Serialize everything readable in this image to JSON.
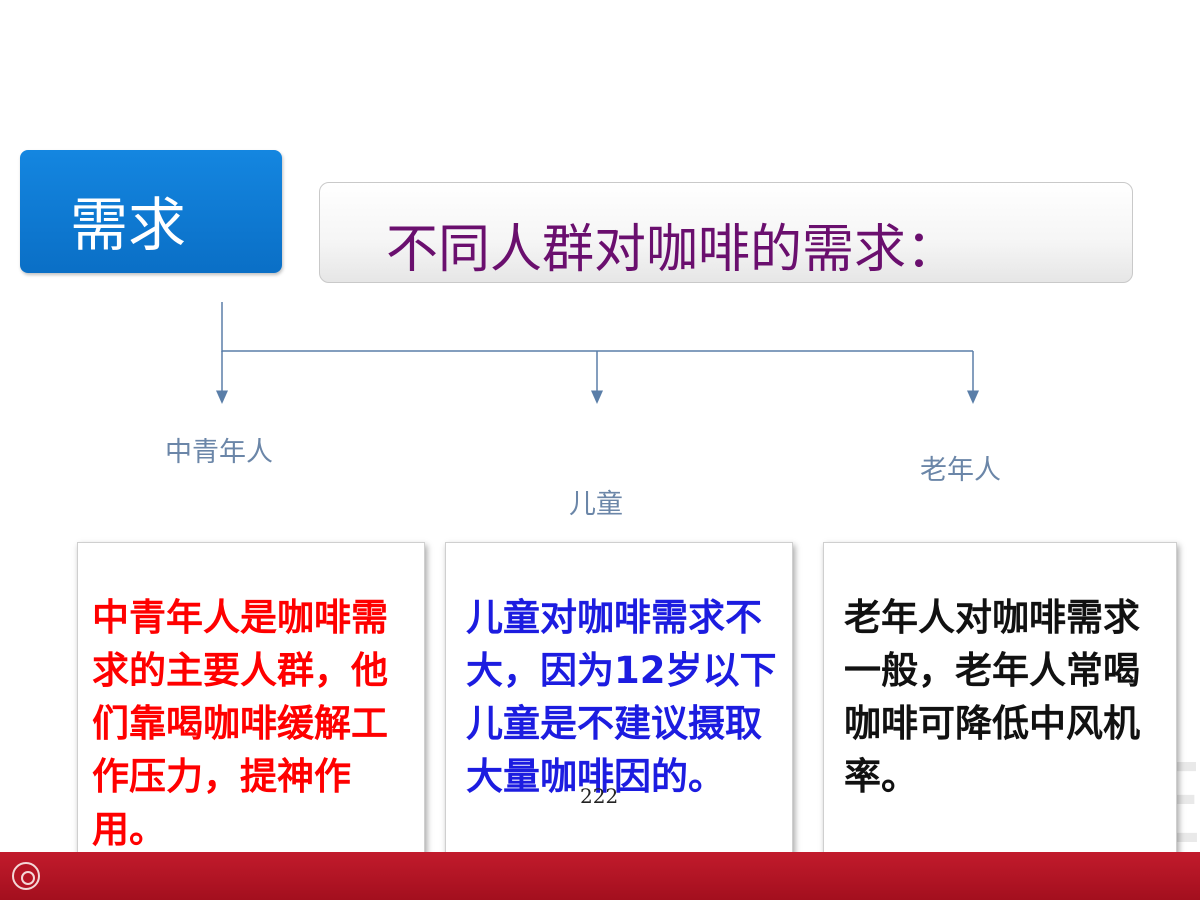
{
  "tag": {
    "label": "需求"
  },
  "title": "不同人群对咖啡的需求：",
  "categories": [
    {
      "label": "中青年人"
    },
    {
      "label": "儿童"
    },
    {
      "label": "老年人"
    }
  ],
  "cards": [
    {
      "text": "中青年人是咖啡需求的主要人群，他们靠喝咖啡缓解工作压力，提神作用。",
      "color": "#ff0000"
    },
    {
      "text": "儿童对咖啡需求不大，因为12岁以下儿童是不建议摄取大量咖啡因的。",
      "color": "#1c1ce0"
    },
    {
      "text": "老年人对咖啡需求一般，老年人常喝咖啡可降低中风机率。",
      "color": "#111111"
    }
  ],
  "page_number": "222",
  "colors": {
    "accent_blue": "#0a6fc6",
    "title_purple": "#6a0f6e",
    "footer_red": "#b51424",
    "connector": "#5a7ea8"
  }
}
